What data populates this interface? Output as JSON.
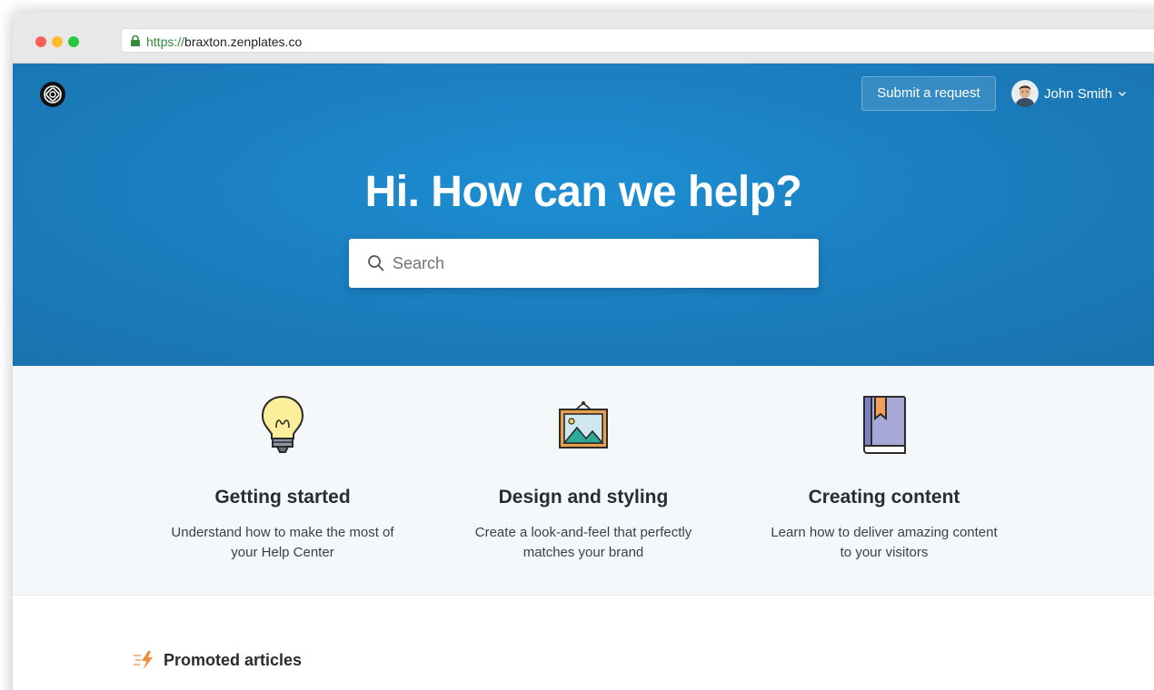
{
  "browser": {
    "url_scheme": "https://",
    "url_host": "braxton.zenplates.co"
  },
  "header": {
    "submit_label": "Submit a request",
    "user_name": "John Smith"
  },
  "hero": {
    "title": "Hi. How can we help?",
    "search_placeholder": "Search",
    "color": "#1b7fc0"
  },
  "categories": [
    {
      "title": "Getting started",
      "desc1": "Understand how to make the most of",
      "desc2": "your Help Center",
      "icon": "lightbulb-icon"
    },
    {
      "title": "Design and styling",
      "desc1": "Create a look-and-feel that perfectly",
      "desc2": "matches your brand",
      "icon": "picture-frame-icon"
    },
    {
      "title": "Creating content",
      "desc1": "Learn how to deliver amazing content",
      "desc2": "to your visitors",
      "icon": "book-icon"
    }
  ],
  "promoted": {
    "title": "Promoted articles",
    "icon": "lightning-icon"
  }
}
